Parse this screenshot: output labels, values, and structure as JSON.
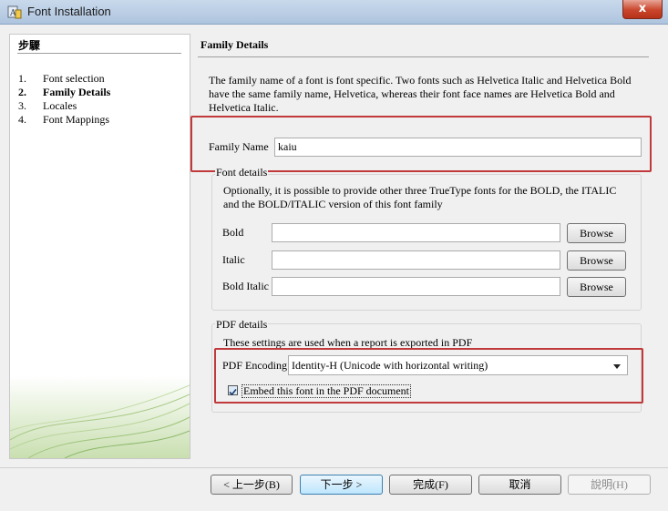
{
  "window": {
    "title": "Font Installation",
    "close_glyph": "x"
  },
  "sidebar": {
    "title": "步驟",
    "steps": [
      {
        "num": "1.",
        "label": "Font selection"
      },
      {
        "num": "2.",
        "label": "Family Details"
      },
      {
        "num": "3.",
        "label": "Locales"
      },
      {
        "num": "4.",
        "label": "Font Mappings"
      }
    ],
    "active_step": 1
  },
  "main": {
    "title": "Family Details",
    "description": "The family name of a font is font specific. Two fonts such as Helvetica Italic and Helvetica Bold have the same family name, Helvetica, whereas their font face names are Helvetica Bold and Helvetica Italic.",
    "family_name_label": "Family Name",
    "family_name_value": "kaiu",
    "font_details": {
      "legend": "Font details",
      "description": "Optionally, it is possible to provide other three TrueType fonts for the BOLD, the ITALIC and the BOLD/ITALIC version of this font family",
      "rows": [
        {
          "label": "Bold",
          "value": "",
          "button": "Browse"
        },
        {
          "label": "Italic",
          "value": "",
          "button": "Browse"
        },
        {
          "label": "Bold Italic",
          "value": "",
          "button": "Browse"
        }
      ]
    },
    "pdf_details": {
      "legend": "PDF details",
      "description": "These settings are used when a report is exported in PDF",
      "encoding_label": "PDF Encoding",
      "encoding_value": "Identity-H (Unicode with horizontal writing)",
      "embed_label": "Embed this font in the PDF document",
      "embed_checked": true
    }
  },
  "footer": {
    "back": "< 上一步(B)",
    "next": "下一步 >",
    "finish": "完成(F)",
    "cancel": "取消",
    "help": "說明(H)"
  },
  "colors": {
    "highlight": "#c0393b",
    "titlebar": "#aec4de",
    "close_button": "#c9462c"
  }
}
